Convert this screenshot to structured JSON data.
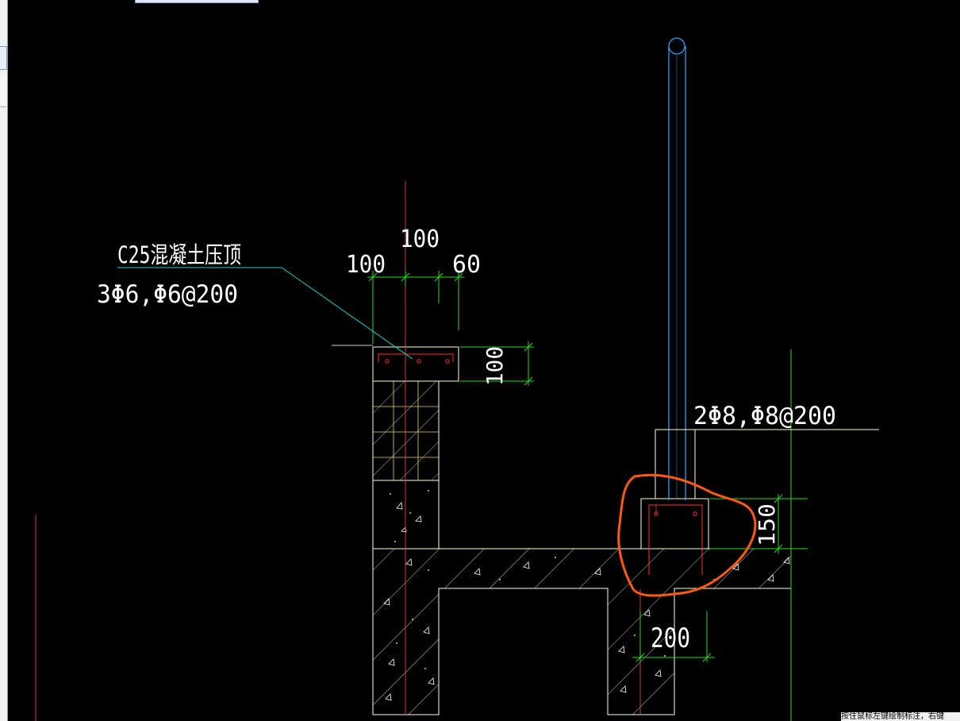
{
  "annotations": {
    "coping_title": "C25混凝土压顶",
    "coping_rebar": "3Φ6,Φ6@200",
    "upstand_rebar": "2Φ8,Φ8@200"
  },
  "dimensions": {
    "top_center": "100",
    "top_left": "100",
    "top_right": "60",
    "coping_height": "100",
    "upstand_height": "150",
    "wall_width": "200"
  },
  "status_bar": {
    "text": "按住鼠标左键绘制标注，右键"
  },
  "colors": {
    "background": "#000000",
    "outline": "#ffffcc",
    "axis_red": "#c8462a",
    "dimension_green": "#22dd22",
    "leader_cyan": "#22cccc",
    "pipe_blue": "#33aaff",
    "rebar_red": "#ff3030",
    "highlight_orange": "#ff5a10"
  }
}
